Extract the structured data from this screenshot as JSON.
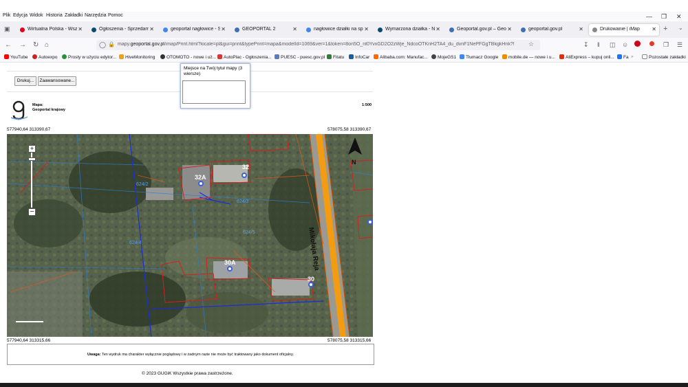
{
  "menu": [
    "Plik",
    "Edycja",
    "Widok",
    "Historia",
    "Zakładki",
    "Narzędzia",
    "Pomoc"
  ],
  "tabs": [
    {
      "label": "Wirtualna Polska - Wszystk",
      "color": "#e2001a"
    },
    {
      "label": "Ogłoszenia - Sprzedam, ku",
      "color": "#0a4a6f"
    },
    {
      "label": "geoportal nagłowice - Szuk",
      "color": "#4285f4"
    },
    {
      "label": "GEOPORTAL 2",
      "color": "#3b6fb6"
    },
    {
      "label": "nagłowice działki na sprze",
      "color": "#4285f4"
    },
    {
      "label": "Wymarzona działka - Nagło",
      "color": "#0a4a6f"
    },
    {
      "label": "Geoportal.gov.pl – Geopor",
      "color": "#3b6fb6"
    },
    {
      "label": "geoportal.gov.pl",
      "color": "#3b6fb6"
    },
    {
      "label": "Drukowanie | iMap",
      "color": "#888888"
    }
  ],
  "url": {
    "prefix": "mapy.",
    "domain": "geoportal.gov.pl",
    "path": "/imap/Print.html?locale=pl&gui=print&typePrint=mapa&modelId=1069&ver=1&token=8on5O_nt0YvxGD2O2zWje_NdcoOTKnH2TA4_du_dvnF1NePFGgTBkgkHnk?!"
  },
  "bookmarks": [
    {
      "label": "YouTube",
      "color": "#ff0000"
    },
    {
      "label": "Autoexpo",
      "color": "#cc2222"
    },
    {
      "label": "Prosty w użyciu edytor...",
      "color": "#2a8f3a"
    },
    {
      "label": "HiveMonitoring",
      "color": "#e8a317"
    },
    {
      "label": "OTOMOTO - nowe i uż...",
      "color": "#333333"
    },
    {
      "label": "AutoPlac - Ogłoszenia...",
      "color": "#d33"
    },
    {
      "label": "PUESC - puesc.gov.pl",
      "color": "#5a7bbd"
    },
    {
      "label": "Fitatu",
      "color": "#2e7d32"
    },
    {
      "label": "InfoCar",
      "color": "#1b5e9e"
    },
    {
      "label": "Alibaba.com: Manufac...",
      "color": "#ff6a00"
    },
    {
      "label": "MojeGS1",
      "color": "#444444"
    },
    {
      "label": "Tłumacz Google",
      "color": "#4285f4"
    },
    {
      "label": "mobile.de — nowe i u...",
      "color": "#f08c00"
    },
    {
      "label": "AliExpress – kupuj onli...",
      "color": "#e62e04"
    },
    {
      "label": "Fa",
      "color": "#1877f2"
    },
    {
      "label": "Pozostałe zakładki",
      "color": "#888888"
    }
  ],
  "print_page": {
    "buttons": {
      "print": "Drukuj...",
      "advanced": "Zaawansowane..."
    },
    "title_popup_label": "Miejsce na Twój tytuł mapy (3 wiersze)",
    "map_label": "Mapa:",
    "map_name": "Geoportal krajowy",
    "scale": "1:500",
    "coord_top_left": "577940,64 313390,67",
    "coord_top_right": "578075,58 313390,67",
    "coord_bottom_left": "577940,64 313315,66",
    "coord_bottom_right": "578075,58 313315,66",
    "note_bold": "Uwaga:",
    "note_text": "Ten wydruk ma charakter wyłącznie poglądowy i w żadnym razie nie może być traktowany jako dokument oficjalny.",
    "footer": "© 2023 GUGiK Wszystkie prawa zastrzeżone."
  },
  "map_labels": {
    "building_32a": "32A",
    "building_32": "32",
    "building_30a": "30A",
    "building_30": "30",
    "parcel_624_2": "624/2",
    "parcel_624_3": "624/3",
    "parcel_624_4": "624/4",
    "parcel_624_5": "624/5",
    "street": "Mikołaja Reja",
    "north": "N"
  }
}
